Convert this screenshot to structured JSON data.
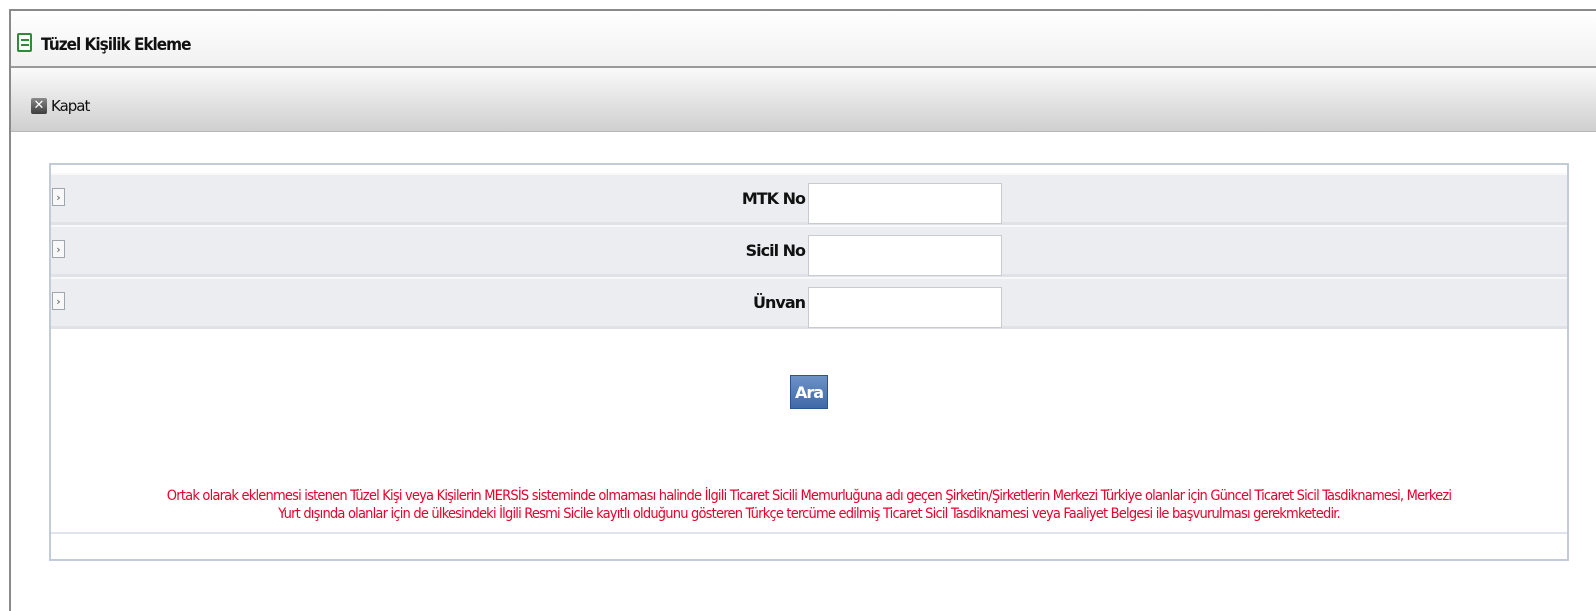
{
  "window": {
    "title": "Tüzel Kişilik Ekleme"
  },
  "toolbar": {
    "close_label": "Kapat"
  },
  "form": {
    "fields": [
      {
        "label": "MTK No :",
        "value": ""
      },
      {
        "label": "Sicil No :",
        "value": ""
      },
      {
        "label": "Ünvan :",
        "value": ""
      }
    ],
    "search_label": "Ara"
  },
  "notice": {
    "line1": "Ortak olarak eklenmesi istenen Tüzel Kişi veya Kişilerin MERSİS sisteminde olmaması halinde İlgili Ticaret Sicili Memurluğuna adı geçen Şirketin/Şirketlerin Merkezi Türkiye olanlar için Güncel Ticaret Sicil Tasdiknamesi, Merkezi",
    "line2": "Yurt dışında olanlar için de ülkesindeki İlgili Resmi Sicile kayıtlı olduğunu gösteren Türkçe tercüme edilmiş Ticaret Sicil Tasdiknamesi veya Faaliyet Belgesi ile başvurulması gerekmketedir.",
    "color": "#e8002a"
  },
  "colors": {
    "title_icon": "#2e8b36",
    "button": "#4f78b8"
  }
}
